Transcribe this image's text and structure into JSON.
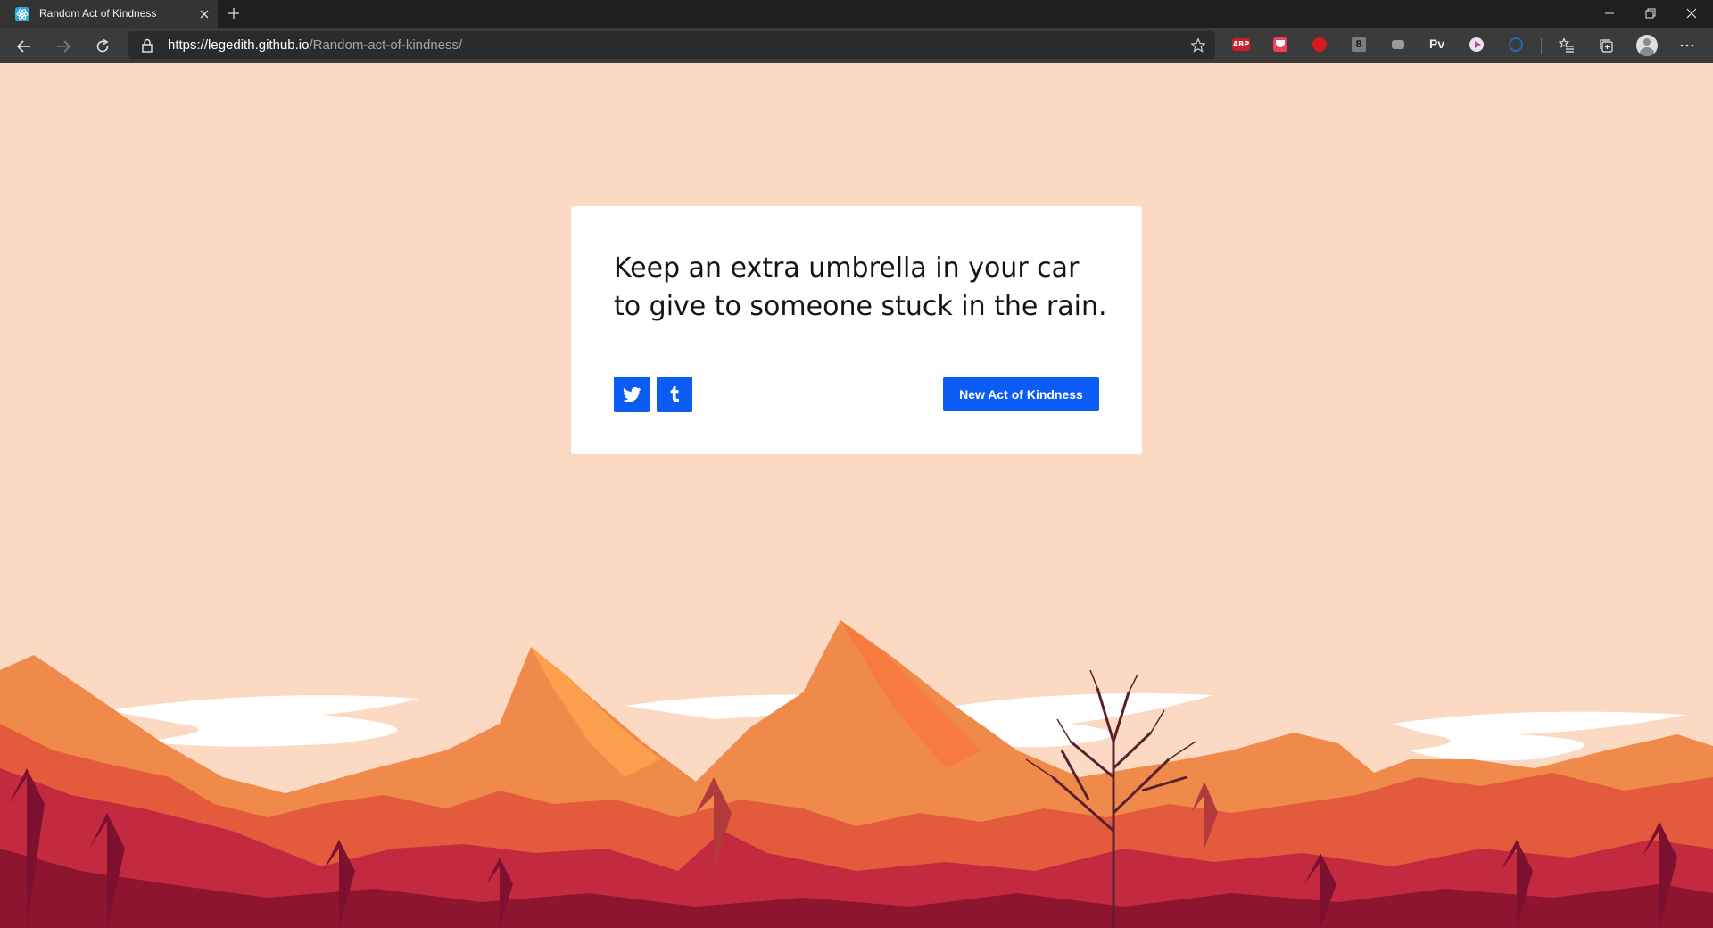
{
  "browser": {
    "tab": {
      "title": "Random Act of Kindness",
      "favicon": "react-atom-icon"
    },
    "address_bar": {
      "url_host": "https://legedith.github.io",
      "url_path": "/Random-act-of-kindness/"
    },
    "extensions": {
      "abp_label": "ABP",
      "grey_ext_label": "8",
      "pv_label": "Pv"
    }
  },
  "page": {
    "quote": "Keep an extra umbrella in your car to give to someone stuck in the rain.",
    "share_twitter_icon": "twitter-icon",
    "share_tumblr_icon": "tumblr-icon",
    "new_button_label": "New Act of Kindness"
  },
  "colors": {
    "background": "#fcd9c3",
    "card": "#ffffff",
    "accent": "#0a5cf5",
    "quote_text": "#141414"
  }
}
